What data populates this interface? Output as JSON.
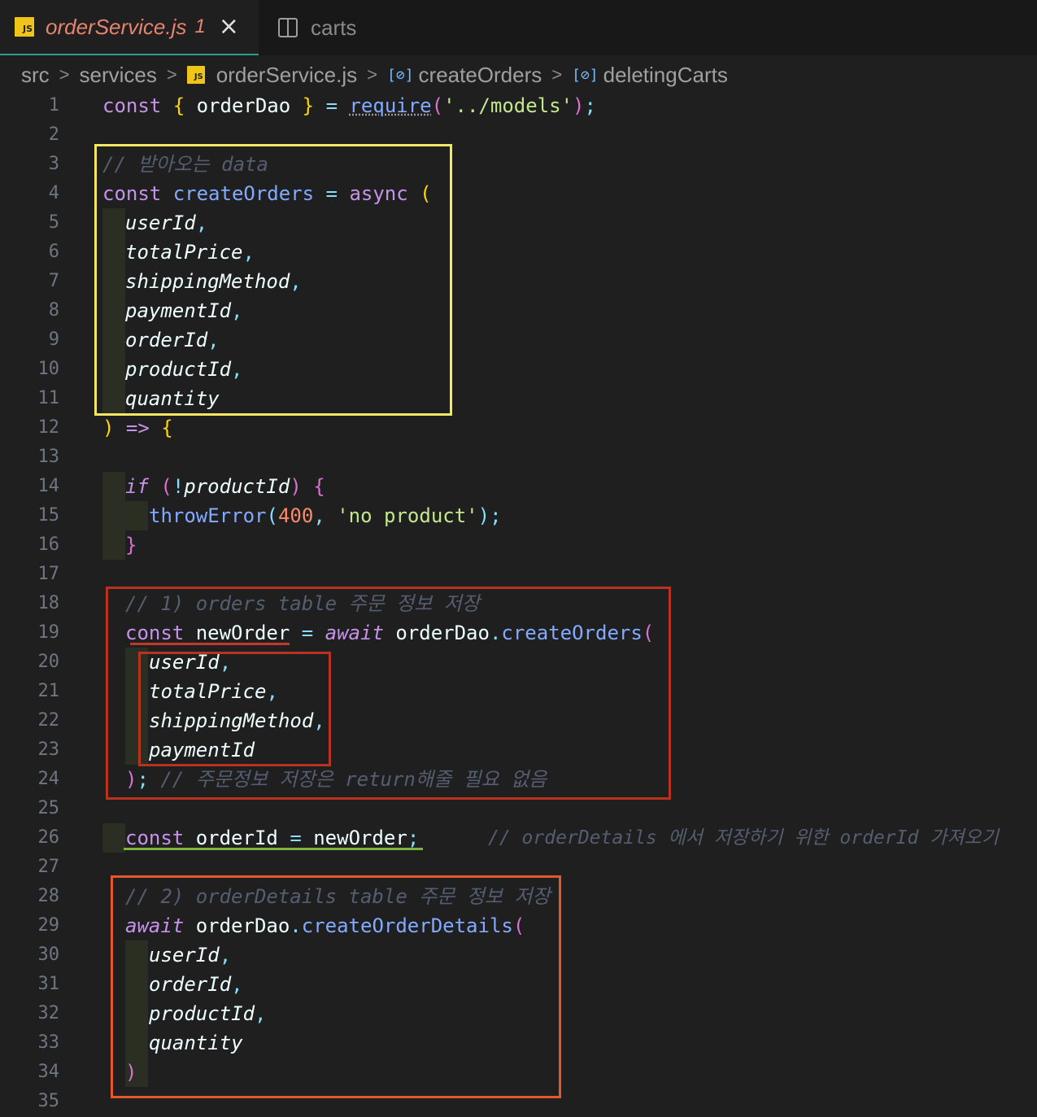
{
  "tabs": [
    {
      "icon": "js-file-icon",
      "icon_text": "JS",
      "title": "orderService.js",
      "problem_count": "1",
      "active": true
    },
    {
      "icon": "split-editor-icon",
      "title": "carts",
      "active": false
    }
  ],
  "breadcrumb": [
    "src",
    "services",
    "orderService.js",
    "createOrders",
    "deletingCarts"
  ],
  "colors": {
    "background": "#1f1f1f",
    "keyword": "#c792ea",
    "function": "#82aaff",
    "string": "#c3e88d",
    "number": "#f78c6c",
    "comment": "#545e70",
    "annotation_yellow": "#f5e663",
    "annotation_red": "#b8321f",
    "annotation_orange": "#e2582c",
    "underline_red": "#c0392b",
    "underline_green": "#7fb33e"
  },
  "code": {
    "line_numbers": [
      "1",
      "2",
      "3",
      "4",
      "5",
      "6",
      "7",
      "8",
      "9",
      "10",
      "11",
      "12",
      "13",
      "14",
      "15",
      "16",
      "17",
      "18",
      "19",
      "20",
      "21",
      "22",
      "23",
      "24",
      "25",
      "26",
      "27",
      "28",
      "29",
      "30",
      "31",
      "32",
      "33",
      "34",
      "35"
    ],
    "l1": {
      "const": "const",
      "open": "{",
      "name": "orderDao",
      "close": "}",
      "eq": "=",
      "req": "require",
      "p1": "(",
      "str": "'../models'",
      "p2": ")",
      "semi": ";"
    },
    "l3": {
      "comment": "// 받아오는 data"
    },
    "l4": {
      "const": "const",
      "name": "createOrders",
      "eq": "=",
      "async": "async",
      "paren": "("
    },
    "l5": {
      "p": "userId",
      "c": ","
    },
    "l6": {
      "p": "totalPrice",
      "c": ","
    },
    "l7": {
      "p": "shippingMethod",
      "c": ","
    },
    "l8": {
      "p": "paymentId",
      "c": ","
    },
    "l9": {
      "p": "orderId",
      "c": ","
    },
    "l10": {
      "p": "productId",
      "c": ","
    },
    "l11": {
      "p": "quantity"
    },
    "l12": {
      "paren": ")",
      "arrow": "=>",
      "brace": "{"
    },
    "l14": {
      "if": "if",
      "p1": "(",
      "not": "!",
      "p": "productId",
      "p2": ")",
      "brace": "{"
    },
    "l15": {
      "fn": "throwError",
      "p1": "(",
      "num": "400",
      "comma": ",",
      "str": "'no product'",
      "p2": ")",
      "semi": ";"
    },
    "l16": {
      "brace": "}"
    },
    "l18": {
      "comment": "// 1) orders table 주문 정보 저장"
    },
    "l19": {
      "const": "const",
      "name": "newOrder",
      "eq": "=",
      "await": "await",
      "obj": "orderDao",
      "dot": ".",
      "fn": "createOrders",
      "paren": "("
    },
    "l20": {
      "p": "userId",
      "c": ","
    },
    "l21": {
      "p": "totalPrice",
      "c": ","
    },
    "l22": {
      "p": "shippingMethod",
      "c": ","
    },
    "l23": {
      "p": "paymentId"
    },
    "l24": {
      "paren": ")",
      "semi": ";",
      "comment": "// 주문정보 저장은 return해줄 필요 없음"
    },
    "l26": {
      "const": "const",
      "name": "orderId",
      "eq": "=",
      "val": "newOrder",
      "semi": ";",
      "comment": "// orderDetails 에서 저장하기 위한 orderId 가져오기"
    },
    "l28": {
      "comment": "// 2) orderDetails table 주문 정보 저장"
    },
    "l29": {
      "await": "await",
      "obj": "orderDao",
      "dot": ".",
      "fn": "createOrderDetails",
      "paren": "("
    },
    "l30": {
      "p": "userId",
      "c": ","
    },
    "l31": {
      "p": "orderId",
      "c": ","
    },
    "l32": {
      "p": "productId",
      "c": ","
    },
    "l33": {
      "p": "quantity"
    },
    "l34": {
      "paren": ")"
    }
  }
}
